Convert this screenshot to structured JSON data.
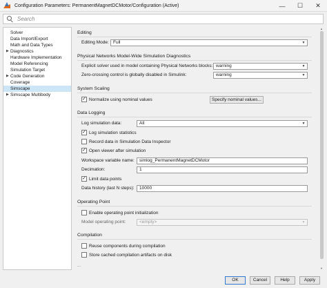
{
  "window": {
    "title": "Configuration Parameters: PermanentMagnetDCMotor/Configuration (Active)",
    "minimize_glyph": "—",
    "maximize_glyph": "☐",
    "close_glyph": "✕"
  },
  "search": {
    "placeholder": "Search",
    "value": ""
  },
  "sidebar": {
    "items": [
      {
        "label": "Solver",
        "expandable": false,
        "selected": false
      },
      {
        "label": "Data Import/Export",
        "expandable": false,
        "selected": false
      },
      {
        "label": "Math and Data Types",
        "expandable": false,
        "selected": false
      },
      {
        "label": "Diagnostics",
        "expandable": true,
        "selected": false
      },
      {
        "label": "Hardware Implementation",
        "expandable": false,
        "selected": false
      },
      {
        "label": "Model Referencing",
        "expandable": false,
        "selected": false
      },
      {
        "label": "Simulation Target",
        "expandable": false,
        "selected": false
      },
      {
        "label": "Code Generation",
        "expandable": true,
        "selected": false
      },
      {
        "label": "Coverage",
        "expandable": false,
        "selected": false
      },
      {
        "label": "Simscape",
        "expandable": false,
        "selected": true
      },
      {
        "label": "Simscape Multibody",
        "expandable": true,
        "selected": false
      }
    ],
    "expand_glyph": "▶"
  },
  "editing": {
    "title": "Editing",
    "mode_label": "Editing Mode:",
    "mode_value": "Full"
  },
  "networks": {
    "title": "Physical Networks Model-Wide Simulation Diagnostics",
    "explicit_label": "Explicit solver used in model containing Physical Networks blocks:",
    "explicit_value": "warning",
    "zero_label": "Zero-crossing control is globally disabled in Simulink:",
    "zero_value": "warning"
  },
  "scaling": {
    "title": "System Scaling",
    "normalize_label": "Normalize using nominal values",
    "normalize_checked": true,
    "specify_button": "Specify nominal values..."
  },
  "logging": {
    "title": "Data Logging",
    "log_label": "Log simulation data:",
    "log_value": "All",
    "stats_label": "Log simulation statistics",
    "stats_checked": true,
    "record_label": "Record data in Simulation Data Inspector",
    "record_checked": false,
    "viewer_label": "Open viewer after simulation",
    "viewer_checked": true,
    "workspace_label": "Workspace variable name:",
    "workspace_value": "simlog_PermanentMagnetDCMotor",
    "decimation_label": "Decimation:",
    "decimation_value": "1",
    "limit_label": "Limit data points",
    "limit_checked": true,
    "history_label": "Data history (last N steps):",
    "history_value": "10000"
  },
  "operating": {
    "title": "Operating Point",
    "enable_label": "Enable operating point initialization",
    "enable_checked": false,
    "model_label": "Model operating point:",
    "model_placeholder": "<empty>"
  },
  "compilation": {
    "title": "Compilation",
    "reuse_label": "Reuse components during compilation",
    "reuse_checked": false,
    "store_label": "Store cached compilation artifacts on disk",
    "store_checked": false,
    "more_glyph": "..."
  },
  "footer": {
    "ok": "OK",
    "cancel": "Cancel",
    "help": "Help",
    "apply": "Apply"
  },
  "colors": {
    "selected_row": "#cde6f7",
    "primary_border": "#2f7ad0"
  },
  "check_glyph": "✓",
  "caret_glyph": "▼"
}
